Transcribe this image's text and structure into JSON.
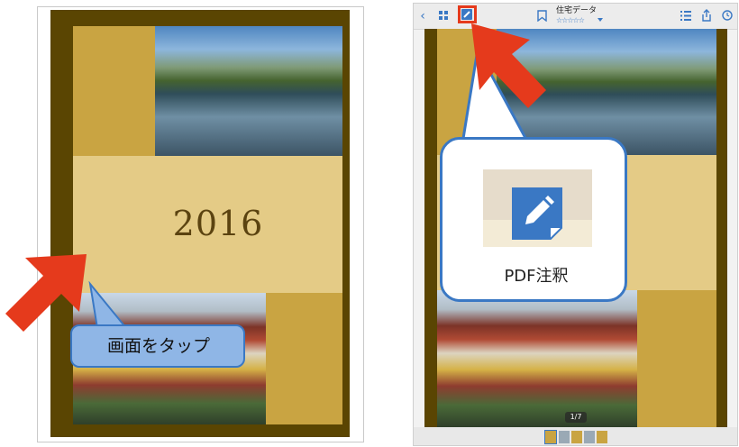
{
  "left": {
    "year_text": "2016",
    "tap_instruction": "画面をタップ"
  },
  "right": {
    "toolbar": {
      "back_icon": "chevron-left-icon",
      "grid_icon": "grid-icon",
      "annotate_icon": "pencil-square-icon",
      "bookmark_icon": "bookmark-icon",
      "doc_title": "住宅データ",
      "rating_stars": "☆☆☆☆☆",
      "list_icon": "list-icon",
      "share_icon": "share-icon",
      "clock_icon": "clock-icon"
    },
    "callout_label": "PDF注釈",
    "page_indicator": "1/7"
  },
  "colors": {
    "accent_blue": "#3a78c4",
    "highlight_red": "#e53a1c",
    "page_dark": "#5a4502",
    "page_gold": "#c9a442",
    "page_tan": "#e4cb86"
  }
}
